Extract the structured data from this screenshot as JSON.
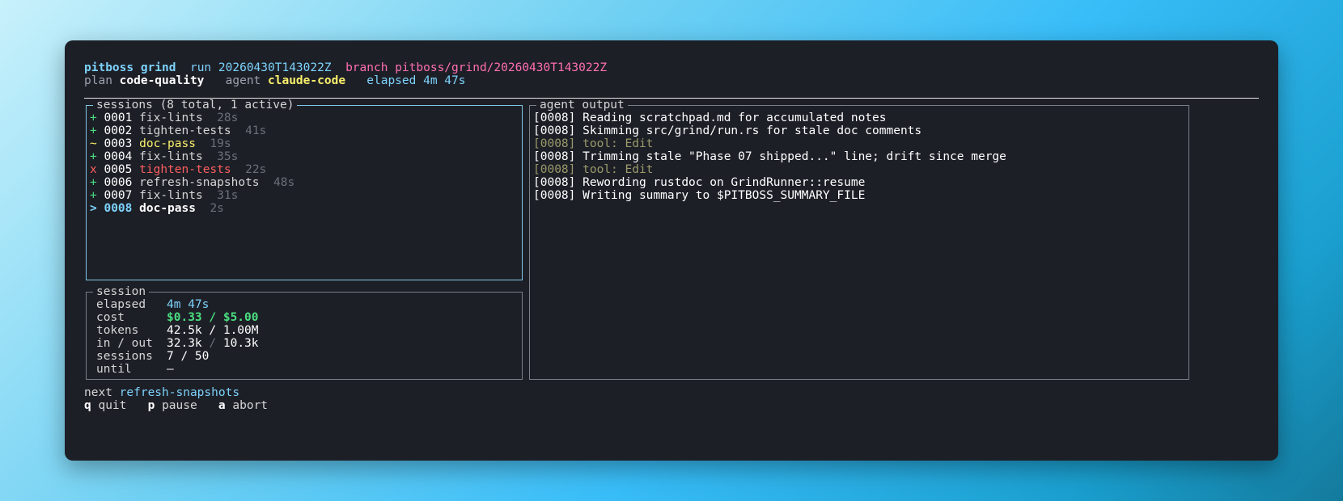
{
  "header": {
    "app": "pitboss grind",
    "run_label": "run",
    "run_id": "20260430T143022Z",
    "branch_label": "branch",
    "branch": "pitboss/grind/20260430T143022Z",
    "plan_label": "plan",
    "plan": "code-quality",
    "agent_label": "agent",
    "agent": "claude-code",
    "elapsed_label": "elapsed",
    "elapsed": "4m 47s"
  },
  "sessions_panel": {
    "title": "sessions (8 total, 1 active)",
    "items": [
      {
        "marker": "+",
        "id": "0001",
        "name": "fix-lints",
        "duration": "28s",
        "status": "done"
      },
      {
        "marker": "+",
        "id": "0002",
        "name": "tighten-tests",
        "duration": "41s",
        "status": "done"
      },
      {
        "marker": "~",
        "id": "0003",
        "name": "doc-pass",
        "duration": "19s",
        "status": "partial"
      },
      {
        "marker": "+",
        "id": "0004",
        "name": "fix-lints",
        "duration": "35s",
        "status": "done"
      },
      {
        "marker": "x",
        "id": "0005",
        "name": "tighten-tests",
        "duration": "22s",
        "status": "failed"
      },
      {
        "marker": "+",
        "id": "0006",
        "name": "refresh-snapshots",
        "duration": "48s",
        "status": "done"
      },
      {
        "marker": "+",
        "id": "0007",
        "name": "fix-lints",
        "duration": "31s",
        "status": "done"
      },
      {
        "marker": ">",
        "id": "0008",
        "name": "doc-pass",
        "duration": "2s",
        "status": "active"
      }
    ]
  },
  "session_panel": {
    "title": "session",
    "elapsed_label": "elapsed",
    "elapsed": "4m 47s",
    "cost_label": "cost",
    "cost": "$0.33 / $5.00",
    "tokens_label": "tokens",
    "tokens": "42.5k / 1.00M",
    "inout_label": "in / out",
    "in": "32.3k",
    "inout_sep": "/",
    "out": "10.3k",
    "sessions_label": "sessions",
    "sessions": "7 / 50",
    "until_label": "until",
    "until": "—"
  },
  "output_panel": {
    "title": "agent output",
    "lines": [
      {
        "text": "[0008] Reading scratchpad.md for accumulated notes",
        "kind": "text"
      },
      {
        "text": "[0008] Skimming src/grind/run.rs for stale doc comments",
        "kind": "text"
      },
      {
        "text": "[0008] tool: Edit",
        "kind": "tool"
      },
      {
        "text": "[0008] Trimming stale \"Phase 07 shipped...\" line; drift since merge",
        "kind": "text"
      },
      {
        "text": "[0008] tool: Edit",
        "kind": "tool"
      },
      {
        "text": "[0008] Rewording rustdoc on GrindRunner::resume",
        "kind": "text"
      },
      {
        "text": "[0008] Writing summary to $PITBOSS_SUMMARY_FILE",
        "kind": "text"
      }
    ]
  },
  "footer": {
    "next_label": "next",
    "next": "refresh-snapshots",
    "keys": [
      {
        "key": "q",
        "label": "quit"
      },
      {
        "key": "p",
        "label": "pause"
      },
      {
        "key": "a",
        "label": "abort"
      }
    ]
  },
  "colors": {
    "window_bg": "#1d1f27",
    "cyan": "#7dd3fc",
    "pink": "#ff6fb1",
    "yellow": "#f9f06b",
    "red": "#ff5f5f",
    "green": "#4ade80",
    "tool_olive": "#9a9a6a"
  }
}
